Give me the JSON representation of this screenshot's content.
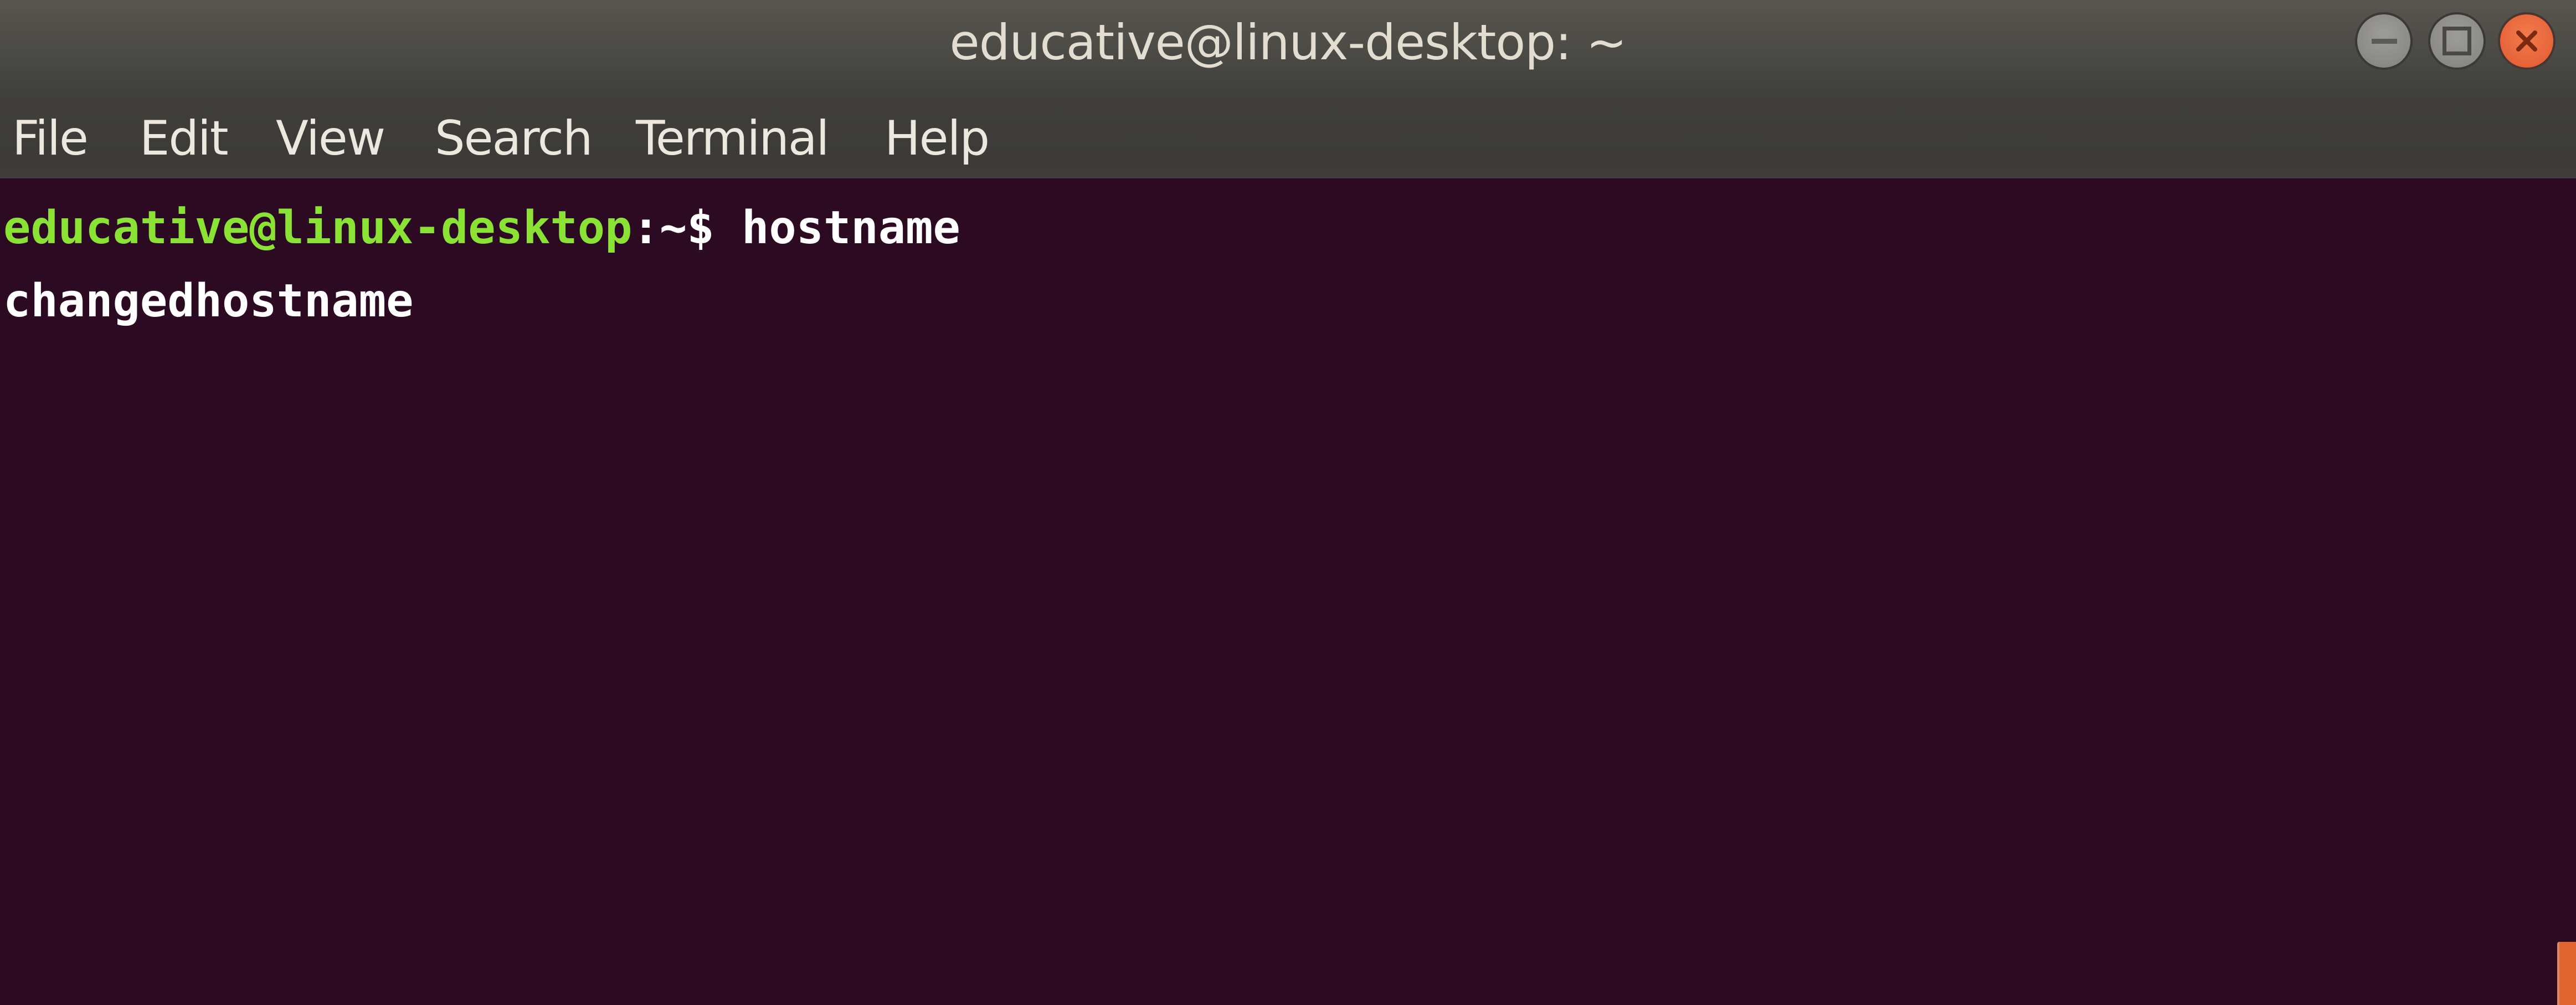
{
  "window": {
    "title": "educative@linux-desktop: ~",
    "controls": {
      "minimize_icon": "minimize-icon",
      "maximize_icon": "maximize-icon",
      "close_icon": "close-icon"
    }
  },
  "menubar": {
    "items": [
      {
        "label": "File"
      },
      {
        "label": "Edit"
      },
      {
        "label": "View"
      },
      {
        "label": "Search"
      },
      {
        "label": "Terminal"
      },
      {
        "label": "Help"
      }
    ]
  },
  "terminal": {
    "lines": [
      {
        "prompt_user_host": "educative@linux-desktop",
        "prompt_path": ":~$",
        "command": " hostname"
      },
      {
        "output": "changedhostname"
      }
    ],
    "colors": {
      "background": "#2c0a22",
      "prompt": "#8ae234",
      "text": "#ffffff"
    }
  },
  "scrollbar": {
    "position": "bottom"
  }
}
